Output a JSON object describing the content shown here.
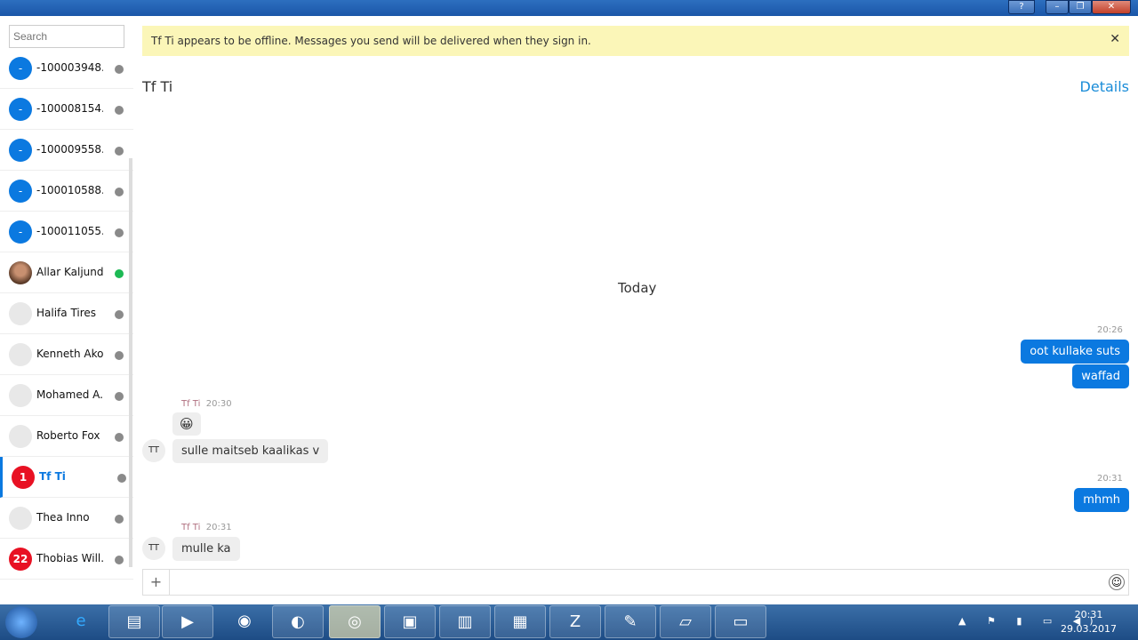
{
  "window": {
    "help": "?",
    "minimize": "–",
    "restore": "❐",
    "close": "✕"
  },
  "search": {
    "placeholder": "Search"
  },
  "contacts": [
    {
      "initial": "-",
      "name": "-100003948...",
      "status": "offline"
    },
    {
      "initial": "-",
      "name": "-100008154...",
      "status": "offline"
    },
    {
      "initial": "-",
      "name": "-100009558...",
      "status": "offline"
    },
    {
      "initial": "-",
      "name": "-100010588...",
      "status": "offline"
    },
    {
      "initial": "-",
      "name": "-100011055...",
      "status": "offline"
    },
    {
      "initial": "",
      "name": "Allar Kaljundi",
      "status": "online"
    },
    {
      "initial": "",
      "name": "Halifa Tires",
      "status": "offline"
    },
    {
      "initial": "",
      "name": "Kenneth Ako...",
      "status": "offline"
    },
    {
      "initial": "",
      "name": "Mohamed A...",
      "status": "offline"
    },
    {
      "initial": "",
      "name": "Roberto Fox",
      "status": "offline"
    },
    {
      "initial": "1",
      "name": "Tf Ti",
      "status": "offline"
    },
    {
      "initial": "",
      "name": "Thea Inno",
      "status": "offline"
    },
    {
      "initial": "22",
      "name": "Thobias Will...",
      "status": "offline"
    }
  ],
  "banner": {
    "text": "Tf Ti appears to be offline.  Messages you send will be delivered when they sign in.",
    "close": "✕"
  },
  "chat": {
    "title": "Tf Ti",
    "details": "Details",
    "day": "Today",
    "messages": [
      {
        "time": "20:26",
        "text1": "oot kullake suts",
        "text2": "waffad"
      },
      {
        "sender": "Tf Ti",
        "time": "20:30",
        "emoji": "😀",
        "text": "sulle maitseb kaalikas v",
        "avatar": "TT"
      },
      {
        "time": "20:31",
        "text": "mhmh"
      },
      {
        "sender": "Tf Ti",
        "time": "20:31",
        "text": "mulle ka",
        "avatar": "TT"
      }
    ]
  },
  "composer": {
    "plus": "+",
    "emoji": "☺"
  },
  "taskbar": {
    "time": "20:31",
    "date": "29.03.2017",
    "tray": "▲ ⚑ ▮ ▭ ◀)"
  }
}
